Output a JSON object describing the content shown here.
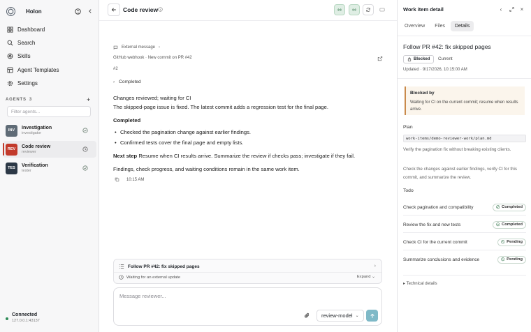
{
  "sidebar": {
    "brand": "Holon",
    "nav": [
      "Dashboard",
      "Search",
      "Skills",
      "Agent Templates",
      "Settings"
    ],
    "agents_label": "AGENTS",
    "agents_count": "3",
    "filter_placeholder": "Filter agents...",
    "agents": [
      {
        "badge": "INV",
        "name": "Investigation",
        "role": "investigator",
        "color": "#5f6b76"
      },
      {
        "badge": "REV",
        "name": "Code review",
        "role": "reviewer",
        "color": "#c23a2b"
      },
      {
        "badge": "TES",
        "name": "Verification",
        "role": "tester",
        "color": "#2c3846"
      }
    ],
    "connection": {
      "status": "Connected",
      "address": "127.0.0.1:43137"
    }
  },
  "main": {
    "title": "Code review",
    "ext_label": "External message",
    "webhook": "GitHub webhook · New commit on PR #42",
    "hash": "#2",
    "completed_toggle": "Completed",
    "line1": "Changes reviewed; waiting for CI",
    "line2": "The skipped-page issue is fixed. The latest commit adds a regression test for the final page.",
    "completed_heading": "Completed",
    "bullets": [
      "Checked the pagination change against earlier findings.",
      "Confirmed tests cover the final page and empty lists."
    ],
    "next_step_label": "Next step",
    "next_step_text": "Resume when CI results arrive. Summarize the review if checks pass; investigate if they fail.",
    "summary": "Findings, check progress, and waiting conditions remain in the same work item.",
    "time": "10:15 AM",
    "card": {
      "title": "Follow PR #42: fix skipped pages",
      "status": "Waiting for an external update",
      "expand": "Expand"
    },
    "composer": {
      "placeholder": "Message reviewer...",
      "model": "review-model"
    }
  },
  "panel": {
    "title": "Work item detail",
    "tabs": [
      "Overview",
      "Files",
      "Details"
    ],
    "item_title": "Follow PR #42: fix skipped pages",
    "badge": "Blocked",
    "current": "Current",
    "updated": "Updated · 9/17/2026, 10:15:00 AM",
    "blocked_by": "Blocked by",
    "blocked_text": "Waiting for CI on the current commit; resume when results arrive.",
    "plan_label": "Plan",
    "plan_path": "work-items/demo-reviewer-work/plan.md",
    "plan_p1": "Verify the pagination fix without breaking existing clients.",
    "plan_p2": "Check the changes against earlier findings, verify CI for this commit, and summarize the review.",
    "todo_label": "Todo",
    "todos": [
      {
        "text": "Check pagination and compatibility",
        "status": "Completed"
      },
      {
        "text": "Review the fix and new tests",
        "status": "Completed"
      },
      {
        "text": "Check CI for the current commit",
        "status": "Pending"
      },
      {
        "text": "Summarize conclusions and evidence",
        "status": "Pending"
      }
    ],
    "technical": "Technical details"
  }
}
